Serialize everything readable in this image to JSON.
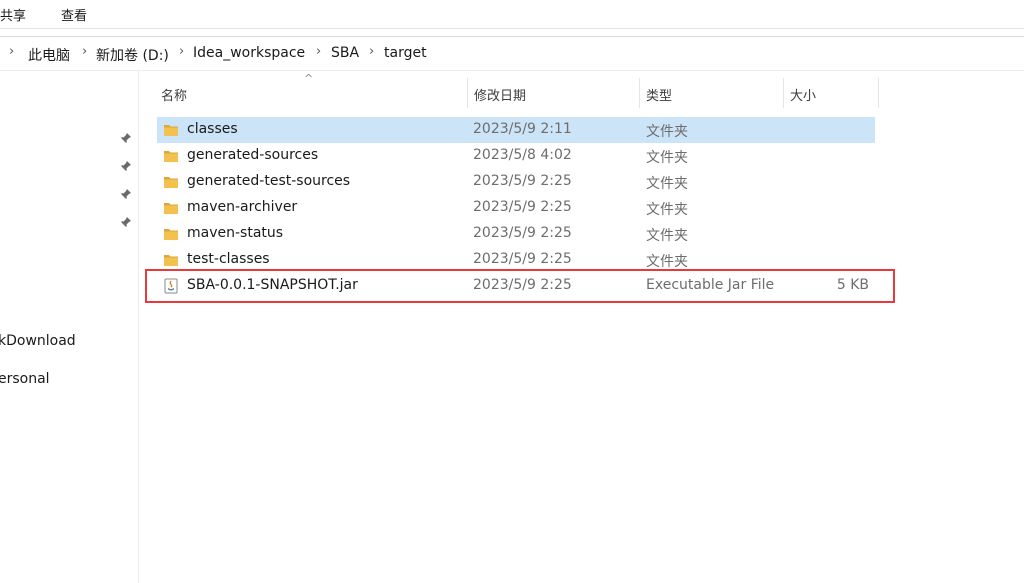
{
  "ribbon": {
    "tabs": [
      "共享",
      "查看"
    ]
  },
  "address": {
    "chevron": "›",
    "crumbs": [
      "此电脑",
      "新加卷 (D:)",
      "Idea_workspace",
      "SBA",
      "target"
    ]
  },
  "nav": {
    "items": [
      "kDownload",
      "ersonal"
    ]
  },
  "columns": {
    "name": "名称",
    "date": "修改日期",
    "type": "类型",
    "size": "大小",
    "sort_indicator": "^"
  },
  "files": [
    {
      "name": "classes",
      "date": "2023/5/9 2:11",
      "type": "文件夹",
      "size": "",
      "icon": "folder-icon",
      "selected": true
    },
    {
      "name": "generated-sources",
      "date": "2023/5/8 4:02",
      "type": "文件夹",
      "size": "",
      "icon": "folder-icon"
    },
    {
      "name": "generated-test-sources",
      "date": "2023/5/9 2:25",
      "type": "文件夹",
      "size": "",
      "icon": "folder-icon"
    },
    {
      "name": "maven-archiver",
      "date": "2023/5/9 2:25",
      "type": "文件夹",
      "size": "",
      "icon": "folder-icon"
    },
    {
      "name": "maven-status",
      "date": "2023/5/9 2:25",
      "type": "文件夹",
      "size": "",
      "icon": "folder-icon"
    },
    {
      "name": "test-classes",
      "date": "2023/5/9 2:25",
      "type": "文件夹",
      "size": "",
      "icon": "folder-icon"
    },
    {
      "name": "SBA-0.0.1-SNAPSHOT.jar",
      "date": "2023/5/9 2:25",
      "type": "Executable Jar File",
      "size": "5 KB",
      "icon": "jar-file-icon"
    }
  ],
  "colors": {
    "folder": "#f2c14e",
    "folder_dark": "#dca83a",
    "selection": "#cce4f7",
    "annotation": "#e8393b"
  }
}
